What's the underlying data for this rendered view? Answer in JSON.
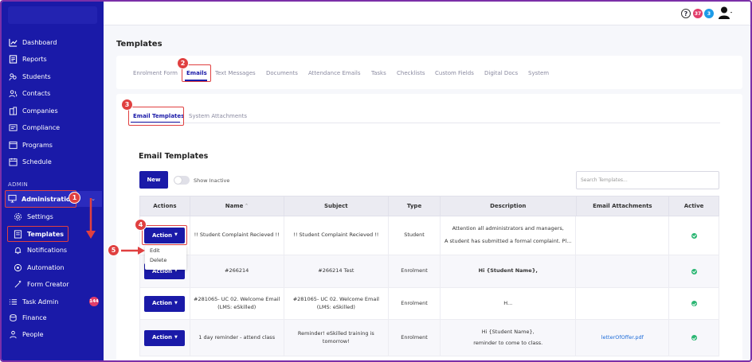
{
  "sidebar": {
    "items": [
      {
        "label": "Dashboard",
        "icon": "chart-icon"
      },
      {
        "label": "Reports",
        "icon": "report-icon"
      },
      {
        "label": "Students",
        "icon": "students-icon"
      },
      {
        "label": "Contacts",
        "icon": "contacts-icon"
      },
      {
        "label": "Companies",
        "icon": "building-icon"
      },
      {
        "label": "Compliance",
        "icon": "compliance-icon"
      },
      {
        "label": "Programs",
        "icon": "programs-icon"
      },
      {
        "label": "Schedule",
        "icon": "calendar-icon"
      }
    ],
    "admin_label": "ADMIN",
    "administration": "Administration",
    "sub_items": [
      {
        "label": "Settings",
        "icon": "gear-icon"
      },
      {
        "label": "Templates",
        "icon": "template-icon"
      },
      {
        "label": "Notifications",
        "icon": "bell-icon"
      },
      {
        "label": "Automation",
        "icon": "automation-icon"
      },
      {
        "label": "Form Creator",
        "icon": "wand-icon"
      }
    ],
    "bottom_items": [
      {
        "label": "Task Admin",
        "icon": "tasks-icon"
      },
      {
        "label": "Finance",
        "icon": "finance-icon"
      },
      {
        "label": "People",
        "icon": "people-icon"
      }
    ],
    "task_badge": "144"
  },
  "topbar": {
    "help": "?",
    "badge_pink": "37",
    "badge_blue": "3"
  },
  "page": {
    "title": "Templates",
    "tabs": [
      "Enrolment Form",
      "Emails",
      "Text Messages",
      "Documents",
      "Attendance Emails",
      "Tasks",
      "Checklists",
      "Custom Fields",
      "Digital Docs",
      "System"
    ],
    "subtabs": [
      "Email Templates",
      "System Attachments"
    ],
    "section_heading": "Email Templates",
    "new_button": "New",
    "show_inactive": "Show Inactive",
    "search_placeholder": "Search Templates..."
  },
  "table": {
    "headers": [
      "Actions",
      "Name",
      "Subject",
      "Type",
      "Description",
      "Email Attachments",
      "Active"
    ],
    "rows": [
      {
        "action": "Action",
        "name": "!! Student Complaint Recieved !!",
        "subject": "!! Student Complaint Recieved !!",
        "type": "Student",
        "desc1": "Attention all administrators and managers,",
        "desc2": "A student has submitted a formal complaint. Pl...",
        "attachments": "",
        "active": true
      },
      {
        "action": "Action",
        "name": "#266214",
        "subject": "#266214 Test",
        "type": "Enrolment",
        "desc1": "Hi {Student Name},",
        "desc2": "",
        "attachments": "",
        "active": true
      },
      {
        "action": "Action",
        "name": "#281065- UC 02. Welcome Email (LMS: eSkilled)",
        "subject": "#281065- UC 02. Welcome Email (LMS: eSkilled)",
        "type": "Enrolment",
        "desc1": "H...",
        "desc2": "",
        "attachments": "",
        "active": true
      },
      {
        "action": "Action",
        "name": "1 day reminder - attend class",
        "subject": "Reminder! eSkilled training is tomorrow!",
        "type": "Enrolment",
        "desc1": "Hi {Student Name},",
        "desc2": "reminder to come to class.",
        "attachments": "letterOfOffer.pdf",
        "active": true
      }
    ]
  },
  "dropdown": {
    "items": [
      "Edit",
      "Delete"
    ]
  },
  "annotations": [
    "1",
    "2",
    "3",
    "4",
    "5"
  ],
  "colors": {
    "brand": "#1a1aa8",
    "annotation": "#e04040",
    "active": "#2bb673"
  }
}
